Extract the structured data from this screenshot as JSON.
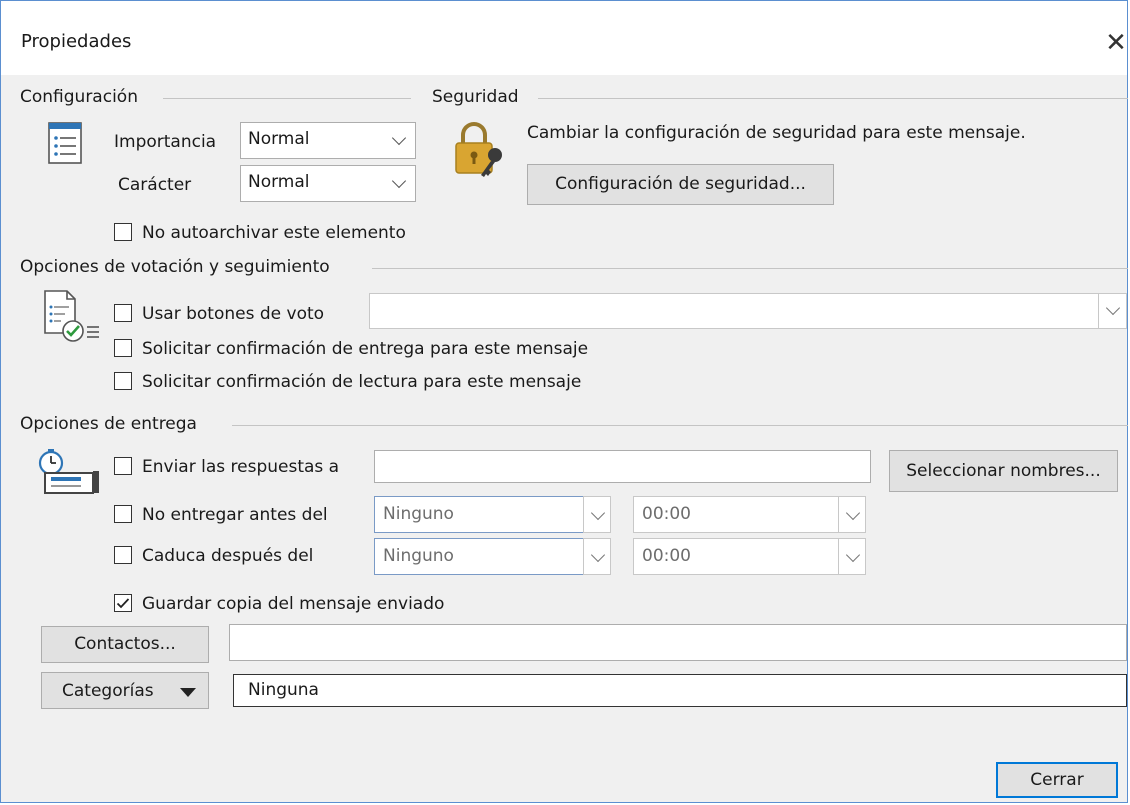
{
  "window": {
    "title": "Propiedades",
    "close_symbol": "✕"
  },
  "configuracion": {
    "label": "Configuración",
    "importancia_label": "Importancia",
    "importancia_value": "Normal",
    "caracter_label": "Carácter",
    "caracter_value": "Normal",
    "no_autoarchivar_label": "No autoarchivar este elemento",
    "no_autoarchivar_checked": false
  },
  "seguridad": {
    "label": "Seguridad",
    "description": "Cambiar la configuración de seguridad para este mensaje.",
    "button": "Configuración de seguridad..."
  },
  "votacion": {
    "label": "Opciones de votación y seguimiento",
    "usar_botones_label": "Usar botones de voto",
    "usar_botones_checked": false,
    "voto_value": "",
    "confirmacion_entrega_label": "Solicitar confirmación de entrega para este mensaje",
    "confirmacion_entrega_checked": false,
    "confirmacion_lectura_label": "Solicitar confirmación de lectura para este mensaje",
    "confirmacion_lectura_checked": false
  },
  "entrega": {
    "label": "Opciones de entrega",
    "enviar_respuestas_label": "Enviar las respuestas a",
    "enviar_respuestas_checked": false,
    "enviar_respuestas_value": "",
    "seleccionar_nombres_button": "Seleccionar nombres...",
    "no_entregar_label": "No entregar antes del",
    "no_entregar_checked": false,
    "no_entregar_date": "Ninguno",
    "no_entregar_time": "00:00",
    "caduca_label": "Caduca después del",
    "caduca_checked": false,
    "caduca_date": "Ninguno",
    "caduca_time": "00:00",
    "guardar_copia_label": "Guardar copia del mensaje enviado",
    "guardar_copia_checked": true
  },
  "contactos": {
    "button": "Contactos...",
    "value": ""
  },
  "categorias": {
    "button": "Categorías",
    "value": "Ninguna"
  },
  "footer": {
    "cerrar_button": "Cerrar"
  },
  "colors": {
    "accent_border": "#5b8fd0",
    "focus_border": "#0078d7",
    "lock_gold": "#d9a531"
  }
}
